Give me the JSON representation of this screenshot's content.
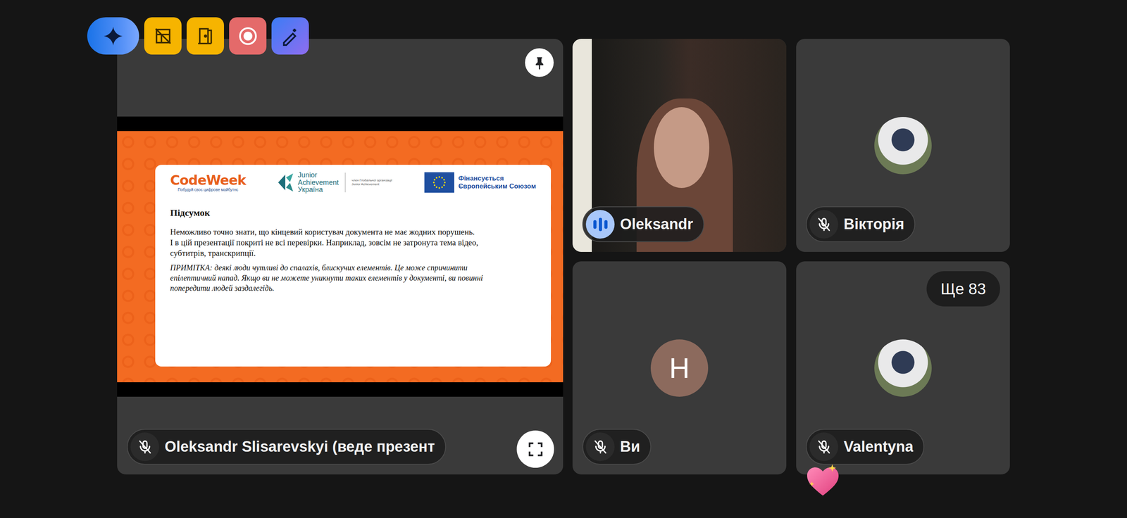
{
  "presentation": {
    "presenter": "Oleksandr Slisarevskyi (веде презент",
    "muted": true,
    "slide": {
      "codeweek": {
        "title": "CodeWeek",
        "subtitle": "Побудуй своє цифрове майбутнє"
      },
      "ja_logo": [
        "Junior",
        "Achievement",
        "Україна"
      ],
      "ja_member": [
        "член Глобальної організації",
        "Junior Achievement"
      ],
      "eu_text": [
        "Фінансується",
        "Європейським Союзом"
      ],
      "title": "Підсумок",
      "paragraphs": [
        "Неможливо точно знати, що кінцевий користувач документа не має жодних порушень.",
        "І в цій презентації покриті не всі перевірки. Наприклад, зовсім не затронута тема відео, субтитрів, транскрипції."
      ],
      "note": "ПРИМІТКА: деякі люди чутливі до спалахів, блискучих елементів. Це може спричинити епілептичний напад. Якщо ви не можете уникнути таких елементів у документі, ви повинні попередити людей заздалегідь."
    }
  },
  "participants": [
    {
      "name": "Oleksandr",
      "kind": "video",
      "speaking": true,
      "muted": false
    },
    {
      "name": "Вікторія",
      "kind": "photo",
      "speaking": false,
      "muted": true
    },
    {
      "name": "Ви",
      "kind": "initial",
      "initial": "H",
      "speaking": false,
      "muted": true
    },
    {
      "name": "Valentyna",
      "kind": "photo",
      "speaking": false,
      "muted": true,
      "badge": "Ще 83"
    }
  ]
}
